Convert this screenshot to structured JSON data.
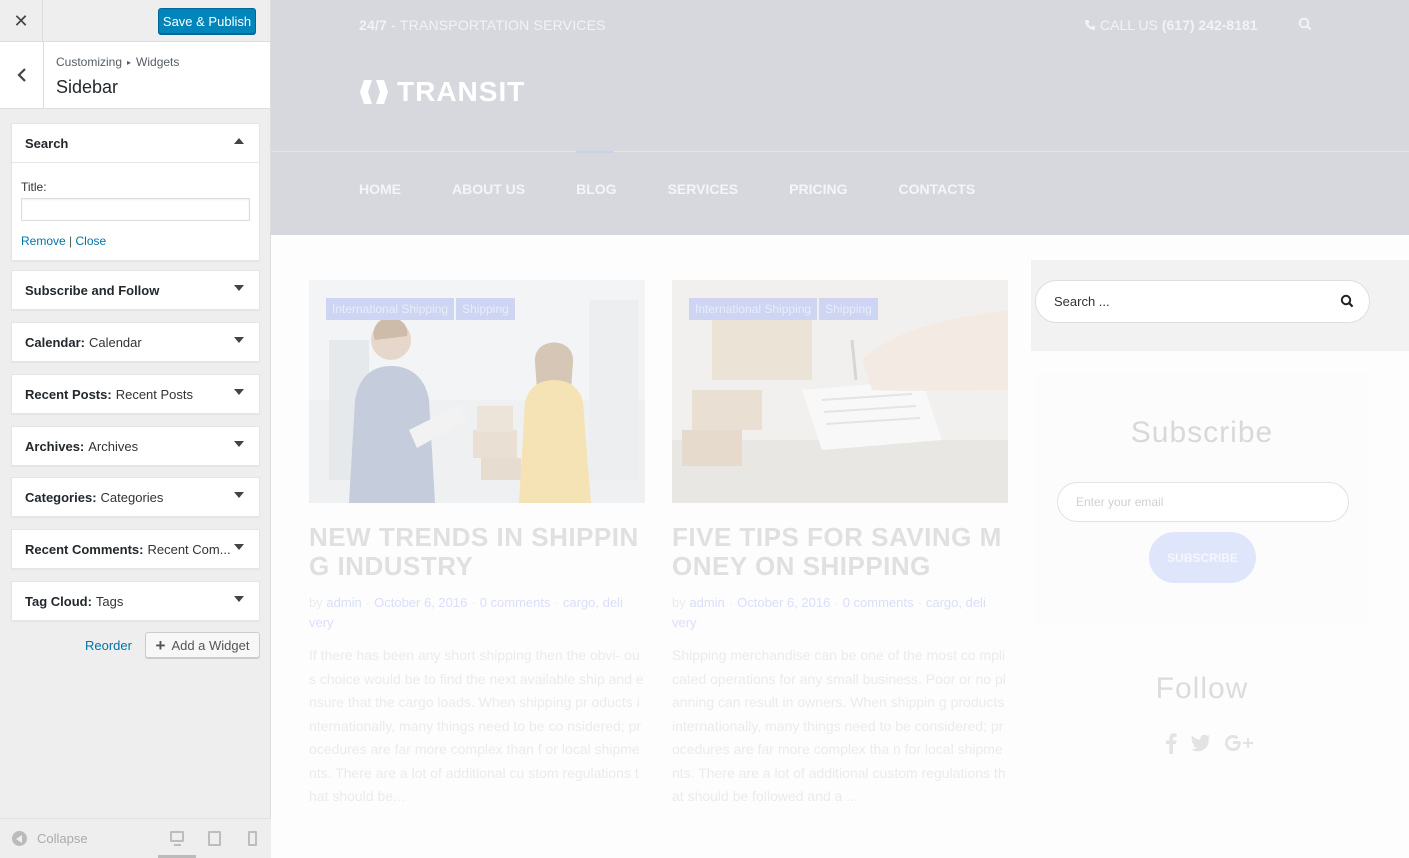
{
  "customizer": {
    "close_glyph": "✕",
    "save_label": "Save & Publish",
    "back_glyph": "‹",
    "breadcrumb": {
      "first": "Customizing",
      "separator": "▸",
      "second": "Widgets"
    },
    "section_title": "Sidebar",
    "widgets": [
      {
        "name": "Search",
        "sub": "",
        "expanded": true
      },
      {
        "name": "Subscribe and Follow",
        "sub": ""
      },
      {
        "name": "Calendar:",
        "sub": "Calendar"
      },
      {
        "name": "Recent Posts:",
        "sub": "Recent Posts"
      },
      {
        "name": "Archives:",
        "sub": "Archives"
      },
      {
        "name": "Categories:",
        "sub": "Categories"
      },
      {
        "name": "Recent Comments:",
        "sub": "Recent Com..."
      },
      {
        "name": "Tag Cloud:",
        "sub": "Tags"
      }
    ],
    "search_widget": {
      "title_label": "Title:",
      "title_value": "",
      "remove_label": "Remove",
      "link_sep": "|",
      "close_label": "Close"
    },
    "reorder_label": "Reorder",
    "add_widget_label": "Add a Widget",
    "add_widget_glyph": "+",
    "collapse_label": "Collapse",
    "devices": [
      "desktop",
      "tablet",
      "mobile"
    ],
    "active_device": "desktop",
    "accent_color": "#0085ba"
  },
  "preview": {
    "tagline": {
      "bold": "24/7",
      "rest": " - TRANSPORTATION SERVICES"
    },
    "phone": {
      "prefix": "CALL US ",
      "number": "(617) 242-8181"
    },
    "logo_text": "TRANSIT",
    "nav": [
      "HOME",
      "ABOUT US",
      "BLOG",
      "SERVICES",
      "PRICING",
      "CONTACTS"
    ],
    "posts": [
      {
        "tags": [
          "International Shipping",
          "Shipping"
        ],
        "title": "NEW TRENDS IN SHIPPIN G INDUSTRY",
        "meta": {
          "by": "by",
          "author": "admin",
          "date": "October 6, 2016",
          "comments": "0 comments",
          "cats": "cargo, deli very"
        },
        "excerpt": "If there has been any short shipping then the obvi- ous choice would be to find the next available ship and ensure that the cargo loads. When shipping pr oducts internationally, many things need to be co nsidered; procedures are far more complex than f or local shipments. There are a lot of additional cu stom regulations that should be..."
      },
      {
        "tags": [
          "International Shipping",
          "Shipping"
        ],
        "title": "FIVE TIPS FOR SAVING M ONEY ON SHIPPING",
        "meta": {
          "by": "by",
          "author": "admin",
          "date": "October 6, 2016",
          "comments": "0 comments",
          "cats": "cargo, deli very"
        },
        "excerpt": "Shipping merchandise can be one of the most co mplicated operations for any small business. Poor or no planning can result in owners. When shippin g products internationally, many things need to be considered; procedures are far more complex tha n for local shipments. There are a lot of additional custom regulations that should be followed and a ..."
      }
    ],
    "sidebar": {
      "search_placeholder": "Search ...",
      "subscribe_title": "Subscribe",
      "email_placeholder": "Enter your email",
      "subscribe_button": "SUBSCRIBE",
      "follow_title": "Follow",
      "social": [
        "facebook-icon",
        "twitter-icon",
        "google-plus-icon"
      ]
    }
  }
}
